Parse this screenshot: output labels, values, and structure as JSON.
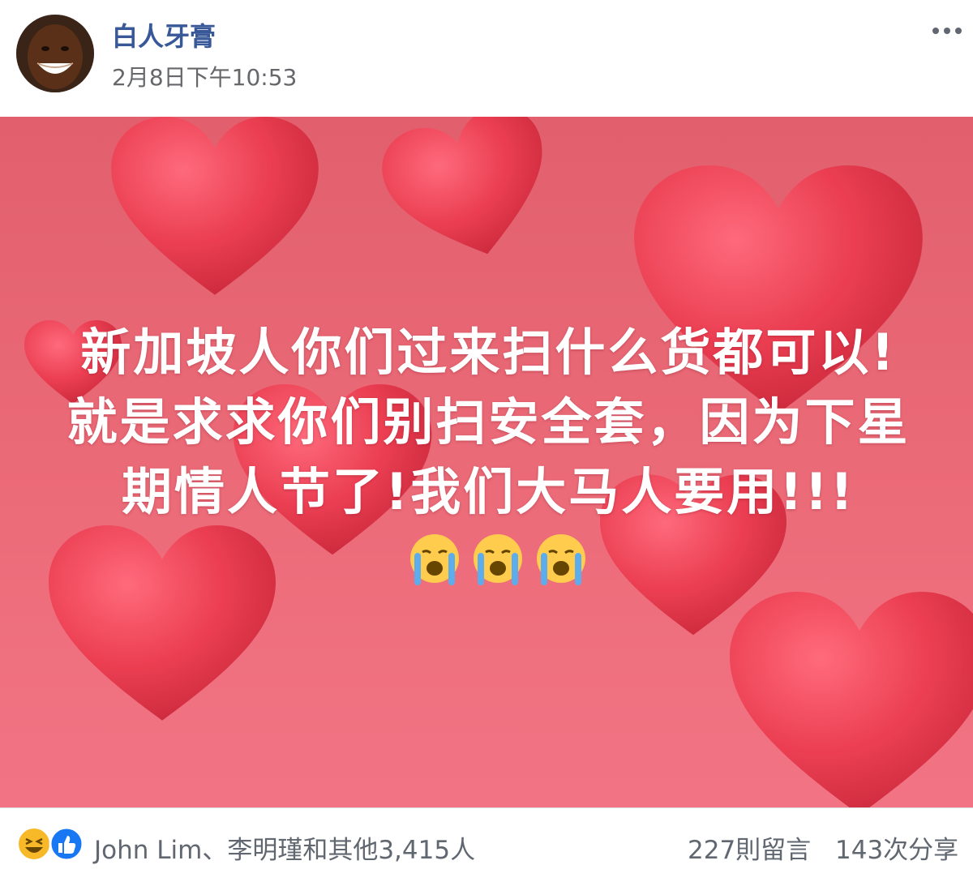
{
  "post": {
    "author": "白人牙膏",
    "time": "2月8日下午10:53",
    "text": "新加坡人你们过来扫什么货都可以!就是求求你们别扫安全套，因为下星期情人节了!我们大马人要用!!!",
    "emoji": [
      "crying-face",
      "crying-face",
      "crying-face"
    ],
    "background_color": "#e8646f"
  },
  "footer": {
    "reactors": "John Lim、李明瑾和其他3,415人",
    "comments": "227則留言",
    "shares": "143次分享",
    "reaction_icons": [
      "laugh",
      "like"
    ]
  },
  "colors": {
    "author": "#385898",
    "meta": "#65676b",
    "like_blue": "#1877f2",
    "haha_yellow": "#f7b928"
  }
}
